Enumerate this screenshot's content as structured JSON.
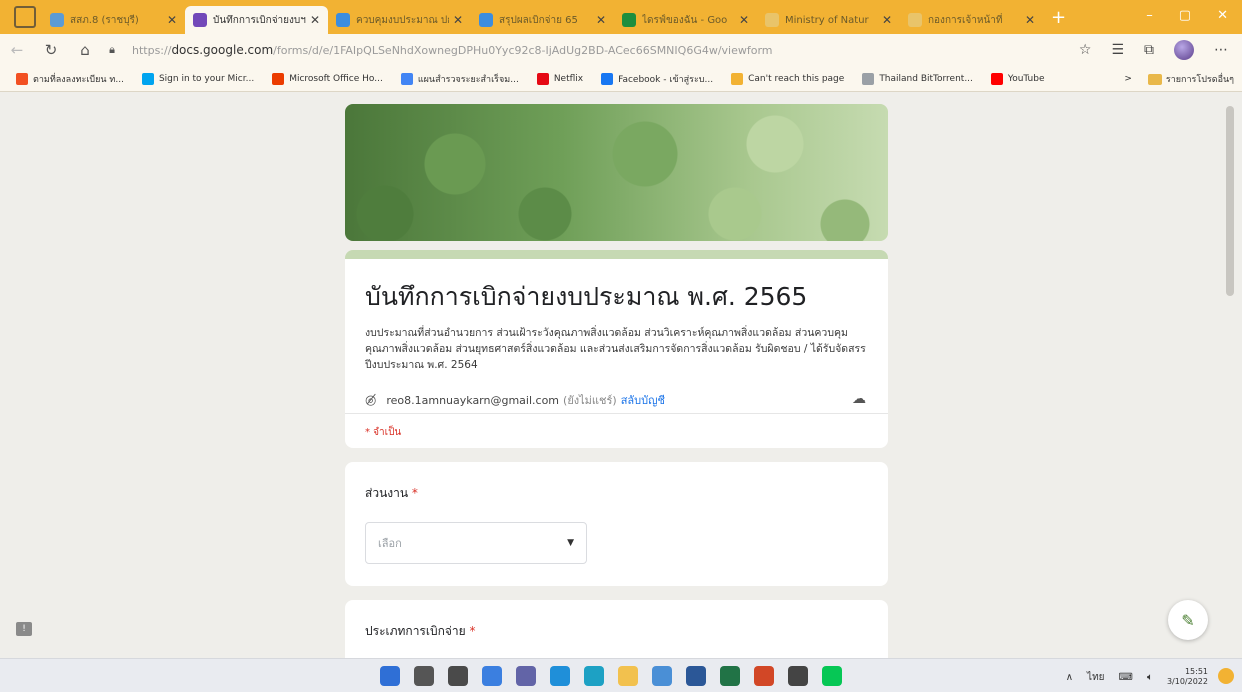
{
  "browser": {
    "tabs": [
      {
        "title": "สสภ.8 (ราชบุรี)",
        "color": "#5b9bd5",
        "active": false
      },
      {
        "title": "บันทึกการเบิกจ่ายงบฯ",
        "color": "#7248b9",
        "active": true
      },
      {
        "title": "ควบคุมงบประมาณ ปก.",
        "color": "#3c8dde",
        "active": false
      },
      {
        "title": "สรุปผลเบิกจ่าย 65",
        "color": "#3c8dde",
        "active": false
      },
      {
        "title": "ไดรฟ์ของฉัน - Goo",
        "color": "#1e8e3e",
        "active": false
      },
      {
        "title": "Ministry of Natur",
        "color": "#e9c46a",
        "active": false
      },
      {
        "title": "กองการเจ้าหน้าที่",
        "color": "#e9c46a",
        "active": false
      }
    ],
    "new_tab": "+",
    "url_prefix": "https://",
    "url_domain": "docs.google.com",
    "url_path": "/forms/d/e/1FAIpQLSeNhdXownegDPHu0Yyc92c8-IjAdUg2BD-ACec66SMNIQ6G4w/viewform",
    "bookmarks": [
      {
        "label": "ตามที่ลงลงทะเบียน ท...",
        "color": "#f25022"
      },
      {
        "label": "Sign in to your Micr...",
        "color": "#00a4ef"
      },
      {
        "label": "Microsoft Office Ho...",
        "color": "#eb3c00"
      },
      {
        "label": "แผนสำรวจระยะสำเร็จม...",
        "color": "#4285f4"
      },
      {
        "label": "Netflix",
        "color": "#e50914"
      },
      {
        "label": "Facebook - เข้าสู่ระบ...",
        "color": "#1877f2"
      },
      {
        "label": "Can't reach this page",
        "color": "#f2b233"
      },
      {
        "label": "Thailand BitTorrent...",
        "color": "#9aa0a6"
      },
      {
        "label": "YouTube",
        "color": "#ff0000"
      }
    ],
    "bookmarks_more": ">",
    "bookmarks_folder": "รายการโปรดอื่นๆ"
  },
  "form": {
    "title": "บันทึกการเบิกจ่ายงบประมาณ พ.ศ. 2565",
    "description": "งบประมาณที่ส่วนอำนวยการ ส่วนเฝ้าระวังคุณภาพสิ่งแวดล้อม ส่วนวิเคราะห์คุณภาพสิ่งแวดล้อม ส่วนควบคุมคุณภาพสิ่งแวดล้อม ส่วนยุทธศาสตร์สิ่งแวดล้อม และส่วนส่งเสริมการจัดการสิ่งแวดล้อม รับผิดชอบ / ได้รับจัดสรร ปีงบประมาณ พ.ศ. 2564",
    "account_email": "reo8.1amnuaykarn@gmail.com",
    "account_status": "(ยังไม่แชร์)",
    "switch_account": "สลับบัญชี",
    "required_note": "* จำเป็น",
    "questions": [
      {
        "label": "ส่วนงาน",
        "required": "*",
        "placeholder": "เลือก"
      },
      {
        "label": "ประเภทการเบิกจ่าย",
        "required": "*"
      }
    ]
  },
  "taskbar": {
    "icons": [
      {
        "name": "windows",
        "color": "#2f6fd6"
      },
      {
        "name": "search",
        "color": "#555555"
      },
      {
        "name": "widgets",
        "color": "#4a4a4a"
      },
      {
        "name": "task-view",
        "color": "#3b7fe0"
      },
      {
        "name": "chat",
        "color": "#6264a7"
      },
      {
        "name": "store",
        "color": "#1f8fd9"
      },
      {
        "name": "edge",
        "color": "#1da1c4"
      },
      {
        "name": "explorer",
        "color": "#f2c14e"
      },
      {
        "name": "files",
        "color": "#4a8fd6"
      },
      {
        "name": "word",
        "color": "#2b5797"
      },
      {
        "name": "excel",
        "color": "#217346"
      },
      {
        "name": "powerpoint",
        "color": "#d24726"
      },
      {
        "name": "app",
        "color": "#444444"
      },
      {
        "name": "line",
        "color": "#06c755"
      }
    ],
    "lang": "ไทย",
    "time": "15:51",
    "date": "3/10/2022"
  }
}
